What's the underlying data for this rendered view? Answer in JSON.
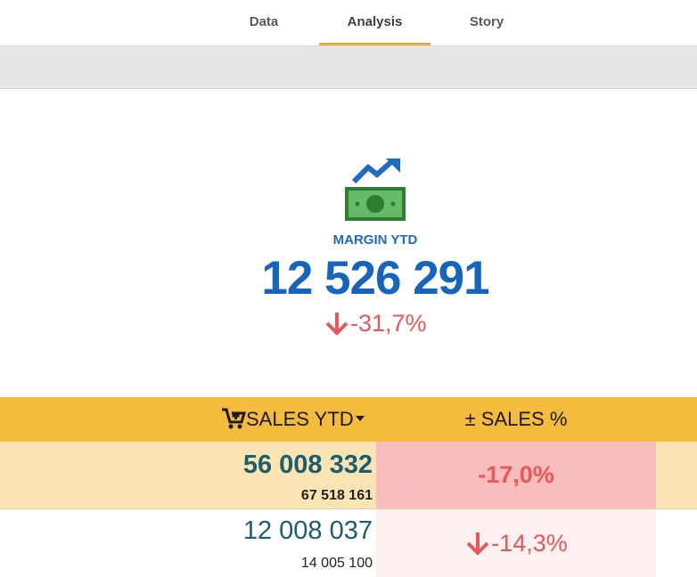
{
  "tabs": [
    {
      "label": "Data"
    },
    {
      "label": "Analysis"
    },
    {
      "label": "Story"
    }
  ],
  "kpi": {
    "icon": "money-growth-icon",
    "title": "MARGIN YTD",
    "value": "12 526 291",
    "delta": "-31,7%",
    "delta_icon": "arrow-down-icon"
  },
  "table": {
    "headers": {
      "sales": "SALES YTD",
      "sales_icon": "cart-icon",
      "sort_icon": "sort-desc-icon",
      "pct": "± SALES %"
    },
    "rows": [
      {
        "sales": "56 008 332",
        "prev": "67 518 161",
        "pct": "-17,0%"
      },
      {
        "sales": "12 008 037",
        "prev": "14 005 100",
        "pct": "-14,3%"
      }
    ]
  },
  "colors": {
    "accent": "#f0a830",
    "kpi_blue": "#1565c0",
    "negative": "#e85858",
    "header_bg": "#f5bb3c"
  }
}
